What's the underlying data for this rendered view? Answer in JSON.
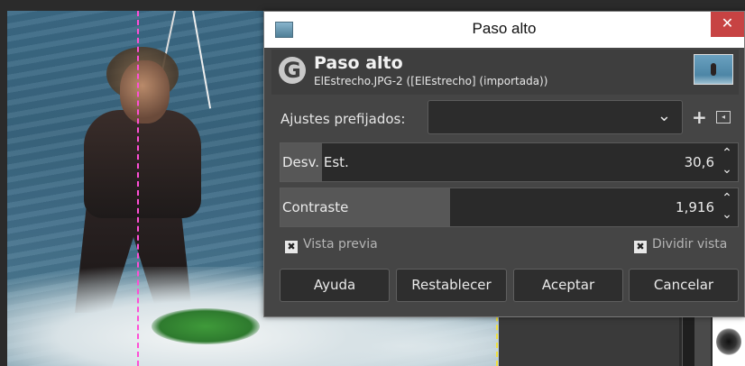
{
  "window": {
    "title": "Paso alto",
    "close_glyph": "✕",
    "app_icon": "gimp-window-icon"
  },
  "header": {
    "logo_glyph": "G",
    "title": "Paso alto",
    "subtitle": "ElEstrecho.JPG-2 ([ElEstrecho] (importada))"
  },
  "presets": {
    "label": "Ajustes prefijados:",
    "value": "",
    "add_glyph": "+",
    "menu_glyph": "◂"
  },
  "params": {
    "desv": {
      "label": "Desv. Est.",
      "value": "30,6",
      "level": 0.09
    },
    "contraste": {
      "label": "Contraste",
      "value": "1,916",
      "level": 0.37
    }
  },
  "options": {
    "preview": {
      "label": "Vista previa",
      "checked": true,
      "mark": "✖"
    },
    "split": {
      "label": "Dividir vista",
      "checked": true,
      "mark": "✖"
    }
  },
  "buttons": {
    "help": "Ayuda",
    "reset": "Restablecer",
    "ok": "Aceptar",
    "cancel": "Cancelar"
  },
  "colors": {
    "split_guide": "#ff4fd6",
    "close_button": "#c74343",
    "dialog_bg": "#454545"
  }
}
